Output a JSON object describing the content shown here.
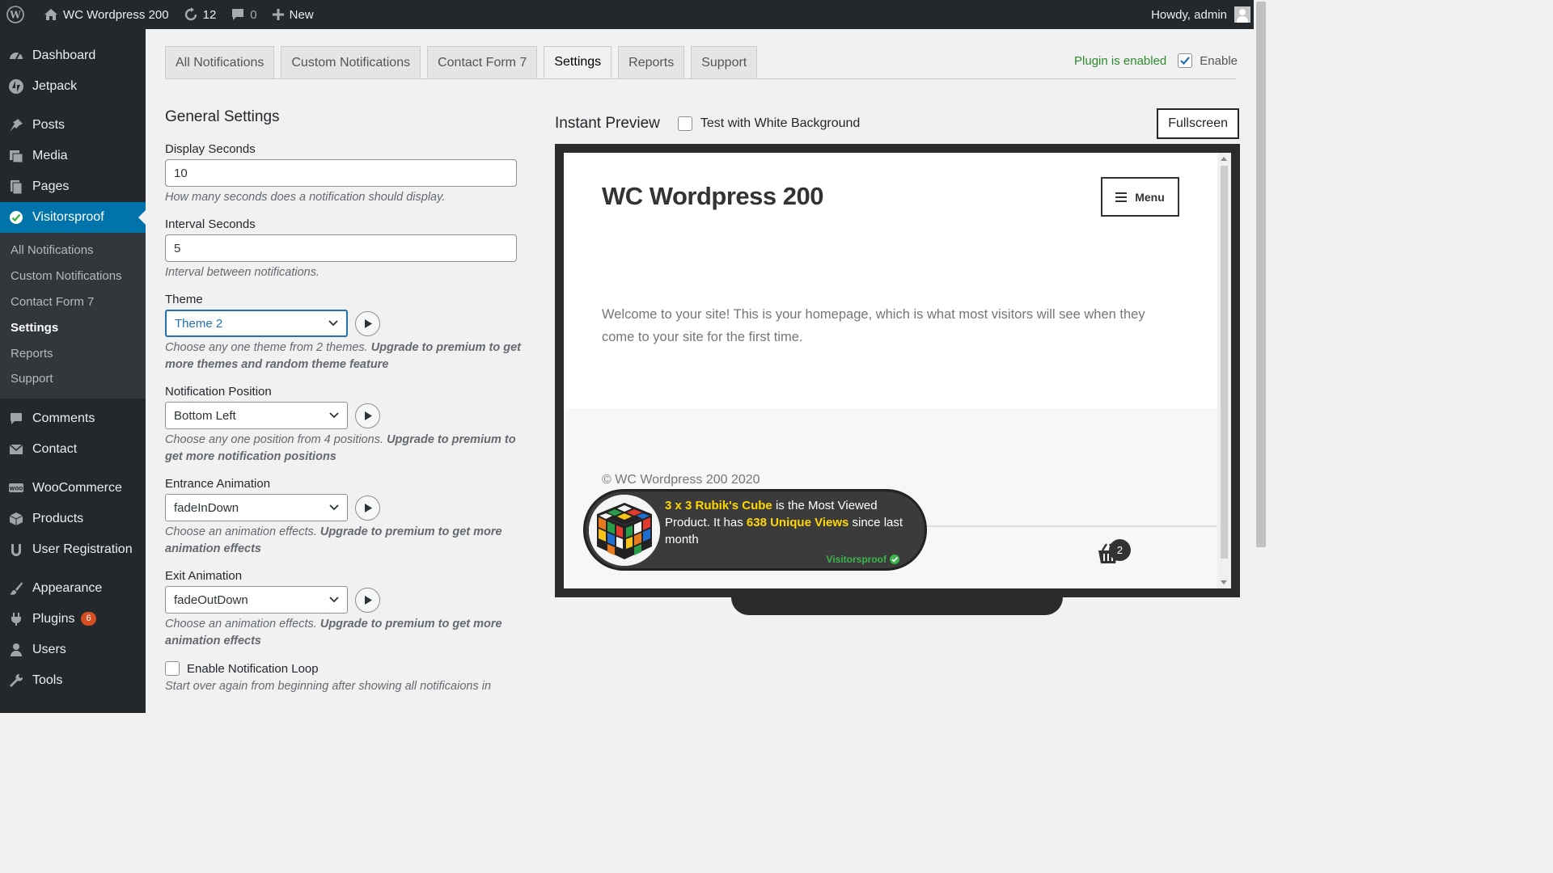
{
  "adminbar": {
    "site_name": "WC Wordpress 200",
    "updates_count": "12",
    "comments_count": "0",
    "new_label": "New",
    "howdy": "Howdy, admin"
  },
  "sidebar": {
    "items": [
      {
        "label": "Dashboard",
        "icon": "dashboard-icon"
      },
      {
        "label": "Jetpack",
        "icon": "jetpack-icon"
      },
      {
        "label": "Posts",
        "icon": "pin-icon"
      },
      {
        "label": "Media",
        "icon": "media-icon"
      },
      {
        "label": "Pages",
        "icon": "pages-icon"
      },
      {
        "label": "Visitorsproof",
        "icon": "check-badge-icon"
      },
      {
        "label": "Comments",
        "icon": "comment-icon"
      },
      {
        "label": "Contact",
        "icon": "mail-icon"
      },
      {
        "label": "WooCommerce",
        "icon": "woo-icon"
      },
      {
        "label": "Products",
        "icon": "box-icon"
      },
      {
        "label": "User Registration",
        "icon": "user-reg-icon"
      },
      {
        "label": "Appearance",
        "icon": "brush-icon"
      },
      {
        "label": "Plugins",
        "icon": "plug-icon",
        "badge": "6"
      },
      {
        "label": "Users",
        "icon": "users-icon"
      },
      {
        "label": "Tools",
        "icon": "wrench-icon"
      }
    ],
    "submenu": [
      "All Notifications",
      "Custom Notifications",
      "Contact Form 7",
      "Settings",
      "Reports",
      "Support"
    ]
  },
  "tabs": [
    "All Notifications",
    "Custom Notifications",
    "Contact Form 7",
    "Settings",
    "Reports",
    "Support"
  ],
  "active_tab": "Settings",
  "status": {
    "plugin_enabled": "Plugin is enabled",
    "enable_label": "Enable",
    "enabled": true
  },
  "settings": {
    "title": "General Settings",
    "display_seconds": {
      "label": "Display Seconds",
      "value": "10",
      "desc": "How many seconds does a notification should display."
    },
    "interval_seconds": {
      "label": "Interval Seconds",
      "value": "5",
      "desc": "Interval between notifications."
    },
    "theme": {
      "label": "Theme",
      "value": "Theme 2",
      "desc": "Choose any one theme from 2 themes.",
      "upgrade": "Upgrade to premium to get more themes and random theme feature"
    },
    "position": {
      "label": "Notification Position",
      "value": "Bottom Left",
      "desc": "Choose any one position from 4 positions.",
      "upgrade": "Upgrade to premium to get more notification positions"
    },
    "entrance": {
      "label": "Entrance Animation",
      "value": "fadeInDown",
      "desc": "Choose an animation effects.",
      "upgrade": "Upgrade to premium to get more animation effects"
    },
    "exit": {
      "label": "Exit Animation",
      "value": "fadeOutDown",
      "desc": "Choose an animation effects.",
      "upgrade": "Upgrade to premium to get more animation effects"
    },
    "loop": {
      "label": "Enable Notification Loop",
      "desc": "Start over again from beginning after showing all notificaions in"
    }
  },
  "preview": {
    "title": "Instant Preview",
    "white_bg_label": "Test with White Background",
    "fullscreen_label": "Fullscreen",
    "site_title": "WC Wordpress 200",
    "menu_label": "Menu",
    "welcome": "Welcome to your site! This is your homepage, which is what most visitors will see when they come to your site for the first time.",
    "copyright": "© WC Wordpress 200 2020",
    "cart_count": "2"
  },
  "notification": {
    "product": "3 x 3 Rubik's Cube",
    "text1": " is the Most Viewed Product. It has ",
    "views": "638 Unique Views",
    "text2": " since last month",
    "brand": "Visitorsproof"
  },
  "colors": {
    "adminbar": "#23282d",
    "accent": "#0073aa",
    "highlight": "#ffd700",
    "enabled_green": "#2e8b2e"
  }
}
